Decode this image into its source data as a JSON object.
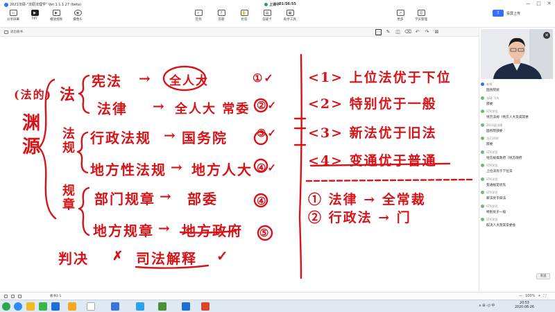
{
  "window": {
    "title": "2021法硕-\"法硕法理学\"  Ver:1.1.1.27 (beta)",
    "live_status": "上课中",
    "live_time": "01:56:55",
    "controls": [
      "—",
      "□",
      "✕"
    ]
  },
  "toolbar_left": [
    {
      "label": "分享屏幕",
      "icon": "screen-share-icon"
    },
    {
      "label": "PPT",
      "icon": "ppt-icon",
      "selected": true
    },
    {
      "label": "播放视频",
      "icon": "video-play-icon"
    },
    {
      "label": "摄像头",
      "icon": "camera-icon"
    }
  ],
  "toolbar_mid": [
    {
      "label": "签到",
      "icon": "signin-icon"
    },
    {
      "label": "答题",
      "icon": "quiz-icon"
    },
    {
      "label": "抢答",
      "icon": "grab-answer-icon"
    },
    {
      "label": "答疑卡",
      "icon": "qa-card-icon"
    },
    {
      "label": "助手工具",
      "icon": "assistant-tools-icon"
    }
  ],
  "toolbar_right": [
    {
      "label": "更多",
      "icon": "share-out-icon"
    },
    {
      "label": "学员管理",
      "icon": "students-icon"
    }
  ],
  "share": {
    "label": "投屏上传"
  },
  "board_toolbar": {
    "exit_label": "退出板书",
    "tools": [
      "crop",
      "pen",
      "eraser",
      "delete",
      "undo",
      "redo",
      "clear"
    ]
  },
  "board": {
    "left_title": [
      "(法的)",
      "渊",
      "源"
    ],
    "left_groups": [
      "法",
      "法规",
      "规章"
    ],
    "rows": [
      {
        "source": "宪法",
        "arrow": "→",
        "organ": "全人大",
        "num": "①✓"
      },
      {
        "source": "法律",
        "arrow": "→",
        "organ": "全人大 常委",
        "num": "②✓"
      },
      {
        "source": "行政法规",
        "arrow": "→",
        "organ": "国务院",
        "num": "③✓"
      },
      {
        "source": "地方性法规",
        "arrow": "→",
        "organ": "地方人大",
        "num": "④✓"
      },
      {
        "source": "部门规章",
        "arrow": "→",
        "organ": "部委",
        "num": "④"
      },
      {
        "source": "地方规章",
        "arrow": "→",
        "organ": "地方政府",
        "num": "⑤"
      }
    ],
    "bottom": [
      "判决",
      "✗",
      "司法解释",
      "✓"
    ],
    "right_rules": [
      "<1> 上位法优于下位",
      "<2> 特别优于一般",
      "<3> 新法优于旧法",
      "<4> 变通优于普通"
    ],
    "right_notes": [
      "① 法律 → 全常裁",
      "② 行政法 → 门"
    ]
  },
  "chat": [
    {
      "name": "老师",
      "text": "国务院呢",
      "avatar": "teacher"
    },
    {
      "name": "法硕-飞鸟",
      "text": "部委",
      "avatar": "green"
    },
    {
      "name": "STK学员",
      "text": "地方法规（地方人大及其常委",
      "avatar": "green"
    },
    {
      "name": "2021届法硕",
      "text": "国务院部委",
      "avatar": "green"
    },
    {
      "name": "法21同学",
      "text": "部委",
      "avatar": "green"
    },
    {
      "name": "STK学员",
      "text": "地方规章政府（地方政府",
      "avatar": "green"
    },
    {
      "name": "STK学员",
      "text": "上位法优于下位法",
      "avatar": "green"
    },
    {
      "name": "STK学员",
      "text": "变通规定优先",
      "avatar": "green"
    },
    {
      "name": "STK学员",
      "text": "新法优于旧法",
      "avatar": "green"
    },
    {
      "name": "STK学员",
      "text": "特别优于一般",
      "avatar": "green"
    },
    {
      "name": "STK学员",
      "text": "取决人大及其常委会",
      "avatar": "green"
    }
  ],
  "chat_send": {
    "label": "发送"
  },
  "statusbar": {
    "label": "板书1-1",
    "zoom": [
      "—",
      "100%",
      "+",
      "⛶"
    ]
  },
  "taskbar": {
    "clock_time": "20:53",
    "clock_date": "2020-06-26",
    "tray_text": "∧  ⊞  ◁)  中"
  },
  "colors": {
    "ink": "#d81318",
    "accent": "#3370ff",
    "taskbar": "#dfe9f3"
  }
}
